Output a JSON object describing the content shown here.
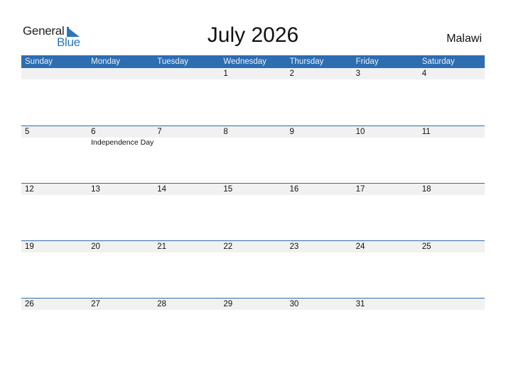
{
  "logo": {
    "line1": "General",
    "line2": "Blue"
  },
  "title": "July 2026",
  "country": "Malawi",
  "colors": {
    "header_bg": "#2d6db0",
    "brand_blue": "#2a77bd",
    "day_band": "#f1f1f1"
  },
  "weekdays": [
    "Sunday",
    "Monday",
    "Tuesday",
    "Wednesday",
    "Thursday",
    "Friday",
    "Saturday"
  ],
  "weeks": [
    {
      "days": [
        "",
        "",
        "",
        "1",
        "2",
        "3",
        "4"
      ],
      "events": [
        "",
        "",
        "",
        "",
        "",
        "",
        ""
      ]
    },
    {
      "days": [
        "5",
        "6",
        "7",
        "8",
        "9",
        "10",
        "11"
      ],
      "events": [
        "",
        "Independence Day",
        "",
        "",
        "",
        "",
        ""
      ]
    },
    {
      "days": [
        "12",
        "13",
        "14",
        "15",
        "16",
        "17",
        "18"
      ],
      "events": [
        "",
        "",
        "",
        "",
        "",
        "",
        ""
      ]
    },
    {
      "days": [
        "19",
        "20",
        "21",
        "22",
        "23",
        "24",
        "25"
      ],
      "events": [
        "",
        "",
        "",
        "",
        "",
        "",
        ""
      ]
    },
    {
      "days": [
        "26",
        "27",
        "28",
        "29",
        "30",
        "31",
        ""
      ],
      "events": [
        "",
        "",
        "",
        "",
        "",
        "",
        ""
      ]
    }
  ]
}
